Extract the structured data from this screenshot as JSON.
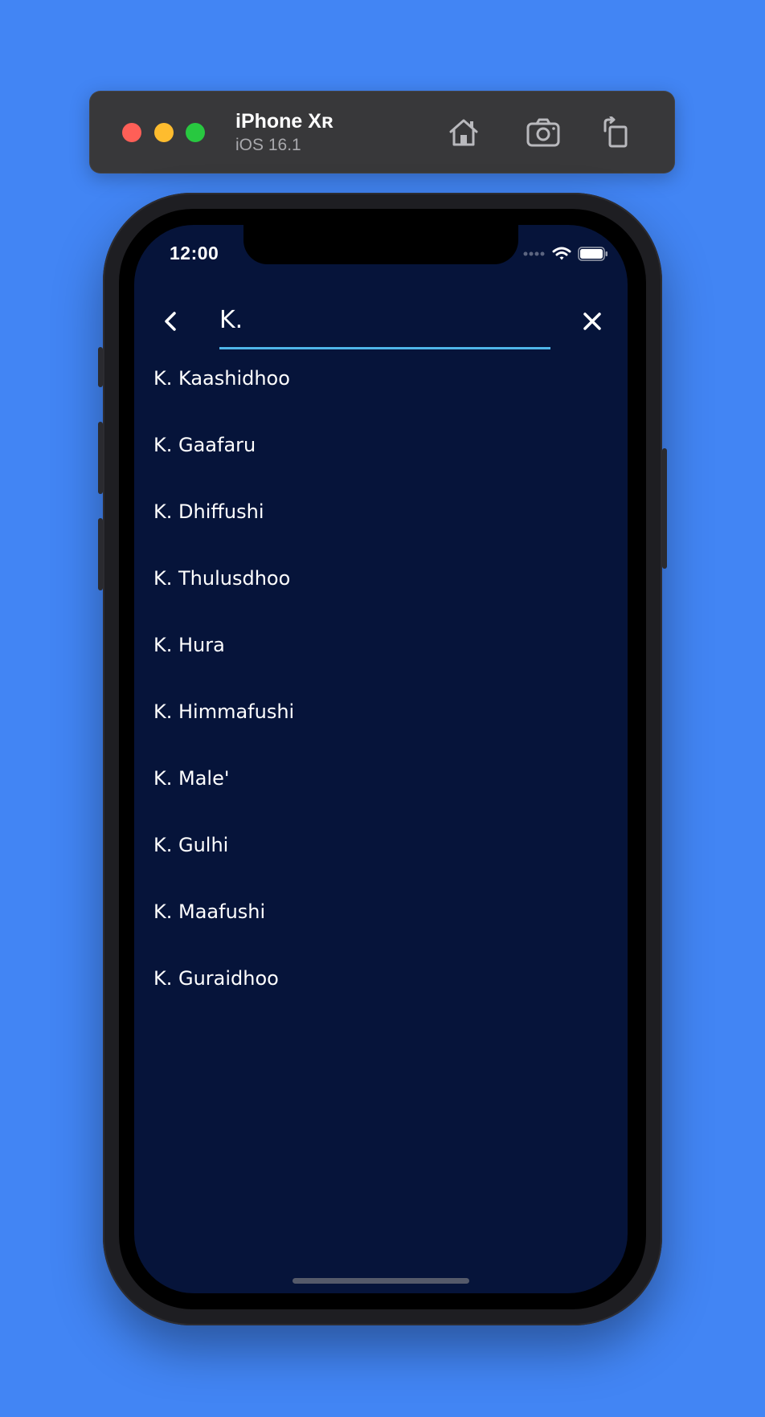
{
  "simulator": {
    "device_name": "iPhone Xʀ",
    "os_version": "iOS 16.1",
    "colors": {
      "close": "#ff5f57",
      "minimize": "#febc2e",
      "zoom": "#28c840"
    },
    "icons": [
      "home-icon",
      "screenshot-icon",
      "rotate-icon"
    ]
  },
  "status_bar": {
    "time": "12:00"
  },
  "search": {
    "value": "K.",
    "accent": "#4fb6e8"
  },
  "results": [
    "K. Kaashidhoo",
    "K. Gaafaru",
    "K. Dhiffushi",
    "K. Thulusdhoo",
    "K. Hura",
    "K. Himmafushi",
    "K. Male'",
    "K. Gulhi",
    "K. Maafushi",
    "K. Guraidhoo"
  ],
  "theme": {
    "background": "#4285f4",
    "screen": "#06143a"
  }
}
